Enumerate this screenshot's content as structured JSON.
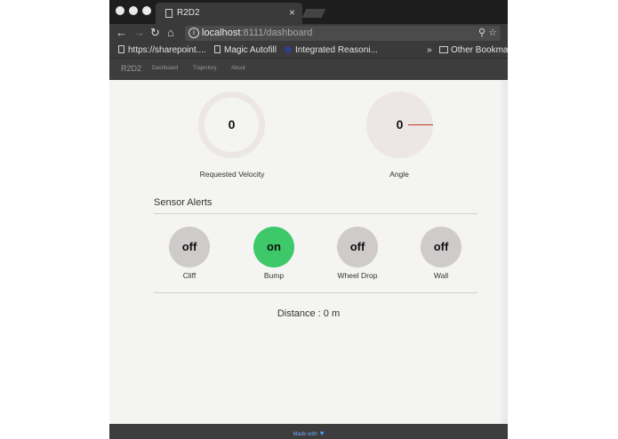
{
  "browser": {
    "tab_title": "R2D2",
    "tab_close": "×",
    "url_host": "localhost",
    "url_rest": ":8111/dashboard",
    "nav": {
      "back": "←",
      "forward": "→",
      "reload": "↻",
      "home": "⌂"
    },
    "omnibox_icons": "⚲ ☆",
    "bookmarks": [
      {
        "label": "https://sharepoint....",
        "icon": "page-icon"
      },
      {
        "label": "Magic Autofill",
        "icon": "page-icon"
      },
      {
        "label": "Integrated Reasoni...",
        "icon": "globe-icon"
      }
    ],
    "bookmarks_overflow": "»",
    "other_bookmarks": "Other Bookmar"
  },
  "app": {
    "brand": "R2D2",
    "nav": [
      "Dashboard",
      "Trajectory",
      "About"
    ]
  },
  "gauges": {
    "velocity": {
      "value": "0",
      "label": "Requested Velocity"
    },
    "angle": {
      "value": "0",
      "label": "Angle"
    }
  },
  "sensors": {
    "title": "Sensor Alerts",
    "items": [
      {
        "label": "Cliff",
        "state": "off"
      },
      {
        "label": "Bump",
        "state": "on"
      },
      {
        "label": "Wheel Drop",
        "state": "off"
      },
      {
        "label": "Wall",
        "state": "off"
      }
    ]
  },
  "distance": "Distance : 0 m",
  "footer": {
    "text": "Made with",
    "heart": "♥"
  },
  "colors": {
    "on": "#3dc86a",
    "off": "#cfcbcb",
    "needle": "#c0392b",
    "navbar": "#3d3d3d"
  }
}
